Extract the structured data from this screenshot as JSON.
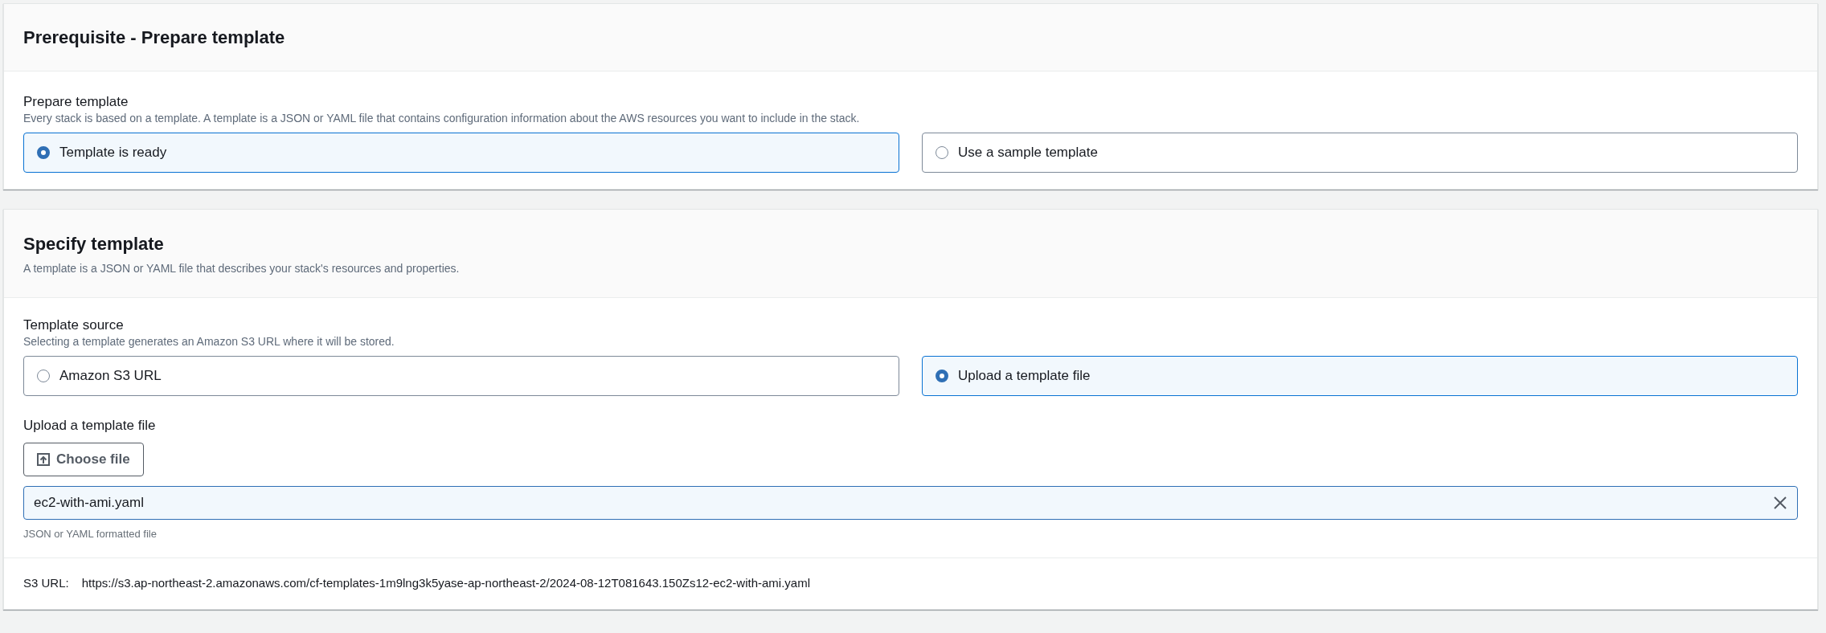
{
  "prerequisite": {
    "title": "Prerequisite - Prepare template",
    "field_label": "Prepare template",
    "description": "Every stack is based on a template. A template is a JSON or YAML file that contains configuration information about the AWS resources you want to include in the stack.",
    "options": [
      {
        "label": "Template is ready",
        "selected": true
      },
      {
        "label": "Use a sample template",
        "selected": false
      }
    ]
  },
  "specify": {
    "title": "Specify template",
    "subtitle": "A template is a JSON or YAML file that describes your stack's resources and properties.",
    "field_label": "Template source",
    "description": "Selecting a template generates an Amazon S3 URL where it will be stored.",
    "options": [
      {
        "label": "Amazon S3 URL",
        "selected": false
      },
      {
        "label": "Upload a template file",
        "selected": true
      }
    ],
    "upload_label": "Upload a template file",
    "choose_button": "Choose file",
    "file_value": "ec2-with-ami.yaml",
    "file_hint": "JSON or YAML formatted file",
    "s3_label": "S3 URL:",
    "s3_url": "https://s3.ap-northeast-2.amazonaws.com/cf-templates-1m9lng3k5yase-ap-northeast-2/2024-08-12T081643.150Zs12-ec2-with-ami.yaml"
  }
}
